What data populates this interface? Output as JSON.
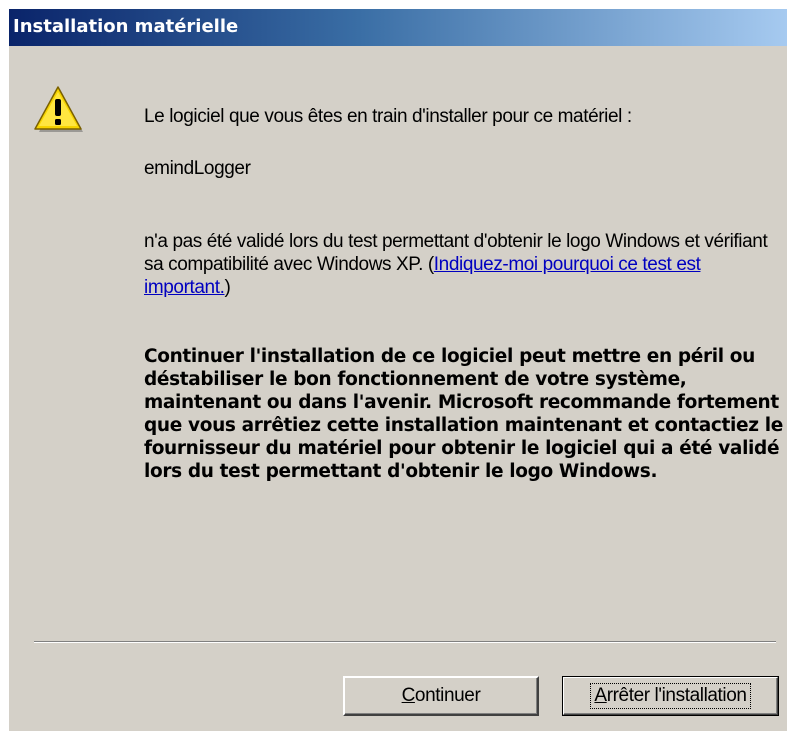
{
  "window": {
    "title": "Installation matérielle"
  },
  "content": {
    "icon": "warning-icon",
    "intro": "Le logiciel que vous êtes en train d'installer pour ce matériel :",
    "device_name": "emindLogger",
    "notice_before_link": "n'a pas été validé lors du test permettant d'obtenir le logo Windows et vérifiant sa compatibilité avec Windows XP. (",
    "notice_link": "Indiquez-moi pourquoi ce test est important.",
    "notice_after_link": ")",
    "warning": "Continuer l'installation de ce logiciel peut mettre en péril ou déstabiliser le bon fonctionnement de votre système, maintenant ou dans l'avenir. Microsoft recommande fortement que vous arrêtiez cette installation maintenant et contactiez le fournisseur du matériel pour obtenir le logiciel qui a été validé lors du test permettant d'obtenir le logo Windows."
  },
  "buttons": {
    "continue_mnemonic": "C",
    "continue_rest": "ontinuer",
    "stop_mnemonic": "A",
    "stop_rest": "rrêter l'installation"
  },
  "colors": {
    "title_gradient_start": "#0a246a",
    "title_gradient_end": "#a6caf0",
    "dialog_face": "#d4d0c8",
    "link": "#0000c0",
    "warning_yellow": "#f7d400"
  }
}
